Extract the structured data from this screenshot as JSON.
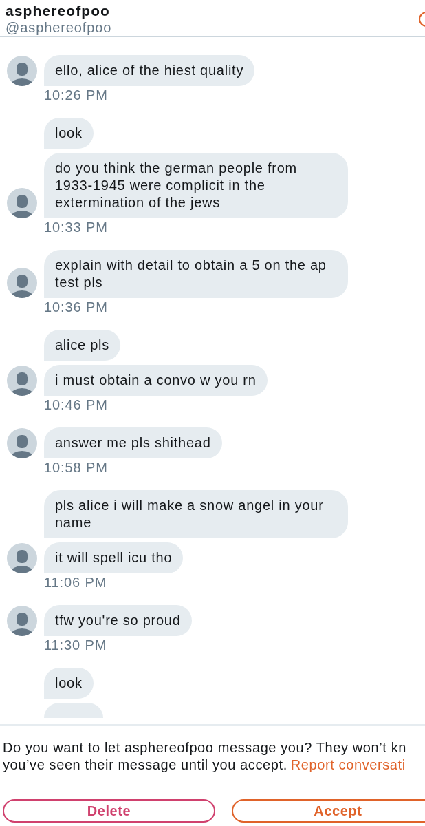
{
  "header": {
    "name": "asphereofpoo",
    "handle": "@asphereofpoo"
  },
  "groups": [
    {
      "messages": [
        "ello, alice of the hiest quality"
      ],
      "time": "10:26 PM"
    },
    {
      "messages": [
        "look",
        "do you think the german people from 1933-1945 were complicit in the extermination of the jews"
      ],
      "time": "10:33 PM"
    },
    {
      "messages": [
        "explain with detail to obtain a 5 on the ap test pls"
      ],
      "time": "10:36 PM"
    },
    {
      "messages": [
        "alice pls",
        "i must obtain a convo w you rn"
      ],
      "time": "10:46 PM"
    },
    {
      "messages": [
        "answer me pls shithead"
      ],
      "time": "10:58 PM"
    },
    {
      "messages": [
        "pls alice i will make a snow angel in your name",
        "it will spell icu tho"
      ],
      "time": "11:06 PM"
    },
    {
      "messages": [
        "tfw you're so proud"
      ],
      "time": "11:30 PM"
    },
    {
      "messages": [
        "look"
      ],
      "partial": true
    }
  ],
  "request": {
    "line1": "Do you want to let asphereofpoo message you? They won’t kn",
    "line2": "you’ve seen their message until you accept.",
    "link": "Report conversati"
  },
  "buttons": [
    {
      "label": "Delete",
      "kind": "delete"
    },
    {
      "label": "Accept",
      "kind": "accept"
    }
  ]
}
